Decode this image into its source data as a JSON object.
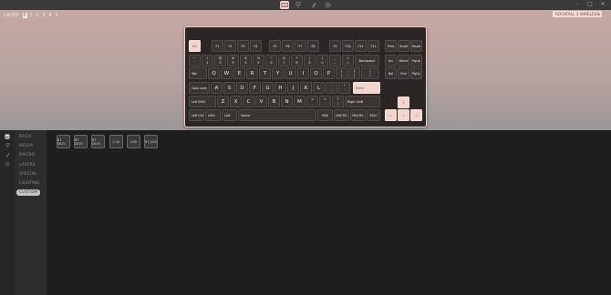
{
  "app": {
    "top_icons": [
      "keyboard-icon",
      "usb-icon",
      "pen-icon",
      "gear-icon"
    ],
    "window_controls": [
      "–",
      "□",
      "✕"
    ]
  },
  "layer_bar": {
    "label": "LAYER",
    "layers": [
      "0",
      "1",
      "2",
      "3",
      "4",
      "5"
    ],
    "active": "0"
  },
  "device_select": {
    "value": "ROCKFALL 3 WIRELESS"
  },
  "keyboard": {
    "keys": {
      "esc": "Esc",
      "f1": "F1",
      "f2": "F2",
      "f3": "F3",
      "f4": "F4",
      "f5": "F5",
      "f6": "F6",
      "f7": "F7",
      "f8": "F8",
      "f9": "F9",
      "f10": "F10",
      "f11": "F11",
      "f12": "F12",
      "print": "Print",
      "scroll": "Scroll",
      "pause": "Pause",
      "grave": [
        "~",
        "`"
      ],
      "n1": [
        "!",
        "1"
      ],
      "n2": [
        "@",
        "2"
      ],
      "n3": [
        "#",
        "3"
      ],
      "n4": [
        "$",
        "4"
      ],
      "n5": [
        "%",
        "5"
      ],
      "n6": [
        "^",
        "6"
      ],
      "n7": [
        "&",
        "7"
      ],
      "n8": [
        "*",
        "8"
      ],
      "n9": [
        "(",
        "9"
      ],
      "n0": [
        ")",
        "0"
      ],
      "minus": [
        "_",
        "-"
      ],
      "equal": [
        "+",
        "="
      ],
      "backspace": "Backspace",
      "ins": "Ins",
      "home": "Home",
      "pgup": "PgUp",
      "tab": "Tab",
      "q": "Q",
      "w": "W",
      "e": "E",
      "r": "R",
      "t": "T",
      "y": "Y",
      "u": "U",
      "i": "I",
      "o": "O",
      "p": "P",
      "lbracket": [
        "{",
        "["
      ],
      "rbracket": [
        "}",
        "]"
      ],
      "backslash": [
        "|",
        "\\"
      ],
      "del": "Del",
      "end": "End",
      "pgdn": "PgDn",
      "caps": "Caps Lock",
      "a": "A",
      "s": "S",
      "d": "D",
      "f": "F",
      "g": "G",
      "h": "H",
      "j": "J",
      "k": "K",
      "l": "L",
      "semicolon": [
        ":",
        ";"
      ],
      "quote": [
        "\"",
        "'"
      ],
      "enter": "Enter",
      "lshift": "Left Shift",
      "z": "Z",
      "x": "X",
      "c": "C",
      "v": "V",
      "b": "B",
      "n": "N",
      "m": "M",
      "comma": [
        "<",
        ","
      ],
      "period": [
        ">",
        "."
      ],
      "slash": [
        "?",
        "/"
      ],
      "rshift": "Right Shift",
      "up": "↑",
      "left": "←",
      "down": "↓",
      "right": "→",
      "lctrl": "Left Ctrl",
      "lwin": "LWin",
      "lalt": "LAlt",
      "space": "Space",
      "ralt": "RAlt",
      "macro2": "MACRO",
      "macro3": "MACRO",
      "rctrl": "RCtrl"
    }
  },
  "sidebar": {
    "icons": [
      "keyboard-icon",
      "usb-icon",
      "pen-icon",
      "gear-icon"
    ],
    "menu": [
      "BASIC",
      "MEDIA",
      "MACRO",
      "LAYERS",
      "SPECIAL",
      "LIGHTING",
      "CUSTOM"
    ],
    "active": "CUSTOM"
  },
  "custom_keys": [
    "BT DEV1",
    "BT DEV2",
    "BT DEV3",
    "2.4G",
    "USB",
    "BT_ADV"
  ]
}
